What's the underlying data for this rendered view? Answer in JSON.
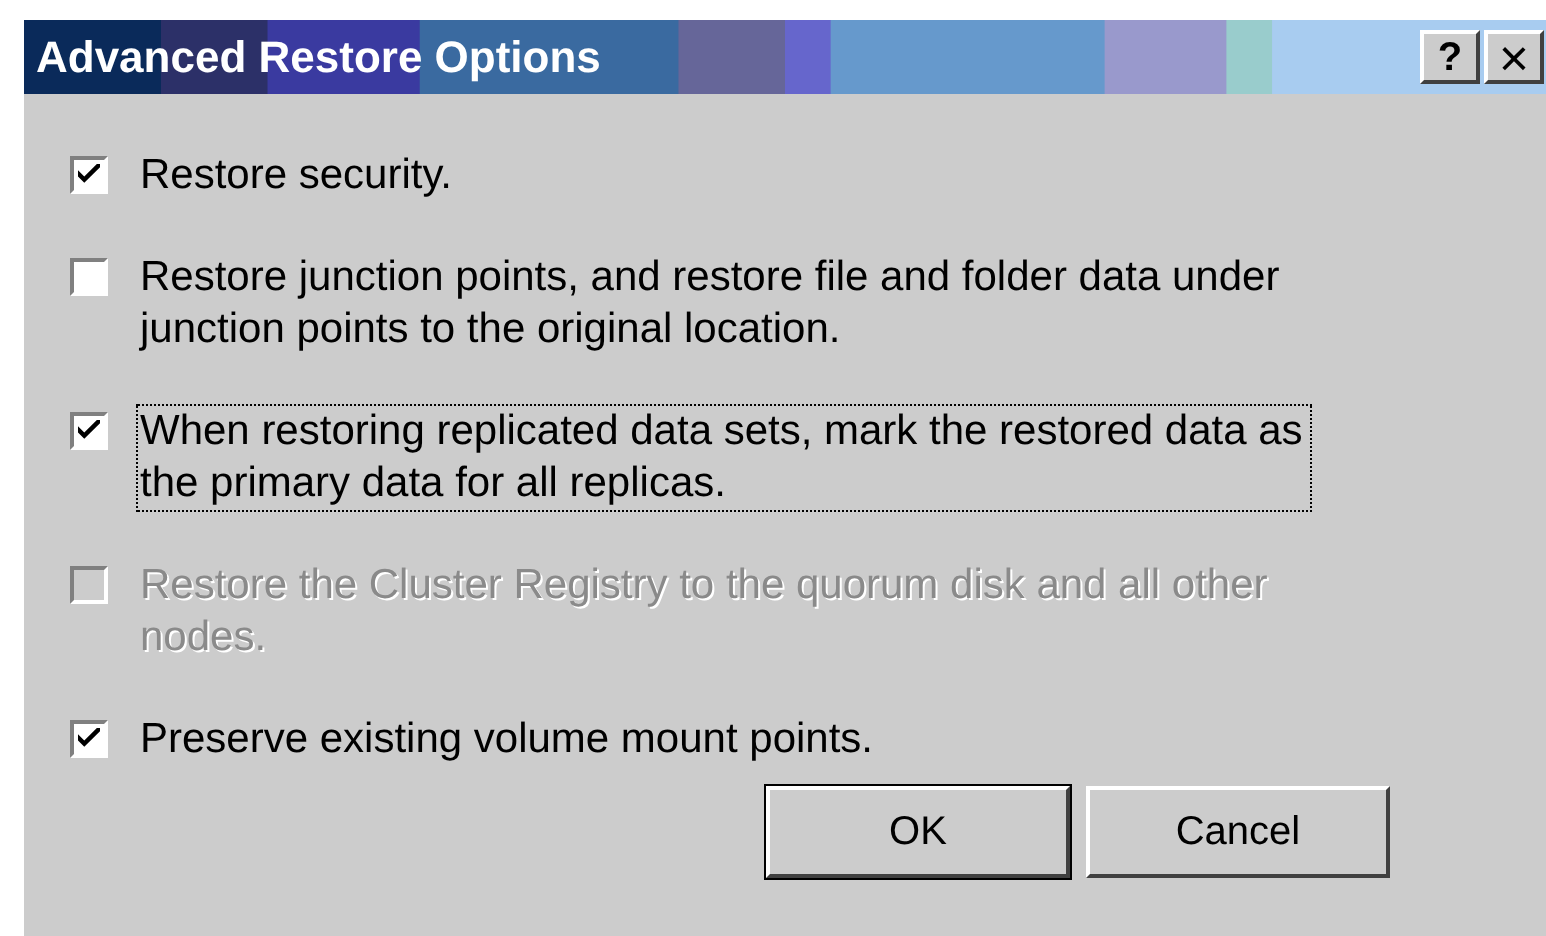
{
  "window": {
    "title": "Advanced Restore Options",
    "title_buttons": [
      {
        "kind": "help",
        "label": "?"
      },
      {
        "kind": "close",
        "label": "×"
      }
    ]
  },
  "options": [
    {
      "label": "Restore security.",
      "checked": true,
      "disabled": false,
      "focused": false
    },
    {
      "label": "Restore junction points, and restore file and folder data under junction points to the original location.",
      "checked": false,
      "disabled": false,
      "focused": false
    },
    {
      "label": "When restoring replicated data sets, mark the restored data as the primary data for all replicas.",
      "checked": true,
      "disabled": false,
      "focused": true
    },
    {
      "label": "Restore the Cluster Registry to the quorum disk and all other nodes.",
      "checked": false,
      "disabled": true,
      "focused": false
    },
    {
      "label": "Preserve existing volume mount points.",
      "checked": true,
      "disabled": false,
      "focused": false
    }
  ],
  "buttons": [
    {
      "label": "OK",
      "default": true
    },
    {
      "label": "Cancel",
      "default": false
    }
  ]
}
